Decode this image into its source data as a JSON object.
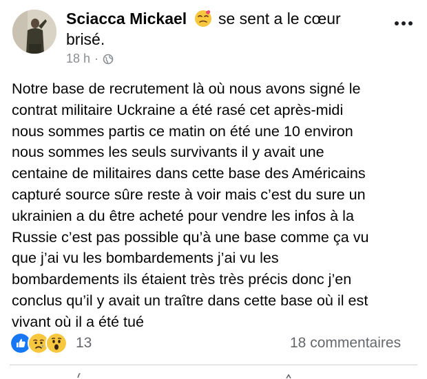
{
  "post": {
    "author": "Sciacca Mickael",
    "feeling_text": "se sent a le cœur",
    "feeling_text_cont": "brisé.",
    "timestamp": "18 h",
    "separator": "·",
    "audience_icon": "globe-icon",
    "body_lines": [
      "Notre base de recrutement là où nous avons signé le",
      "contrat militaire Uckraine a été rasé cet après-midi",
      "nous sommes partis ce matin on été une 10 environ",
      "nous sommes les seuls survivants il y avait une",
      "centaine de militaires dans cette base des Américains",
      "capturé source sûre reste à voir mais c’est du sure un",
      "ukrainien a du être acheté pour vendre les infos à la",
      "Russie c’est pas possible qu’à une base comme ça vu",
      "que j’ai vu les bombardements j’ai vu les",
      "bombardements ils étaient très très précis donc j’en",
      "conclus qu’il y avait un traître dans cette base où il est",
      "vivant où il a été tué"
    ]
  },
  "reactions": {
    "icons": [
      "like-icon",
      "sad-icon",
      "wow-icon"
    ],
    "count": "13"
  },
  "comments": {
    "label": "18 commentaires"
  },
  "colors": {
    "like_blue": "#1877f2",
    "emoji_yellow": "#f7c73f",
    "meta_gray": "#65676b"
  }
}
